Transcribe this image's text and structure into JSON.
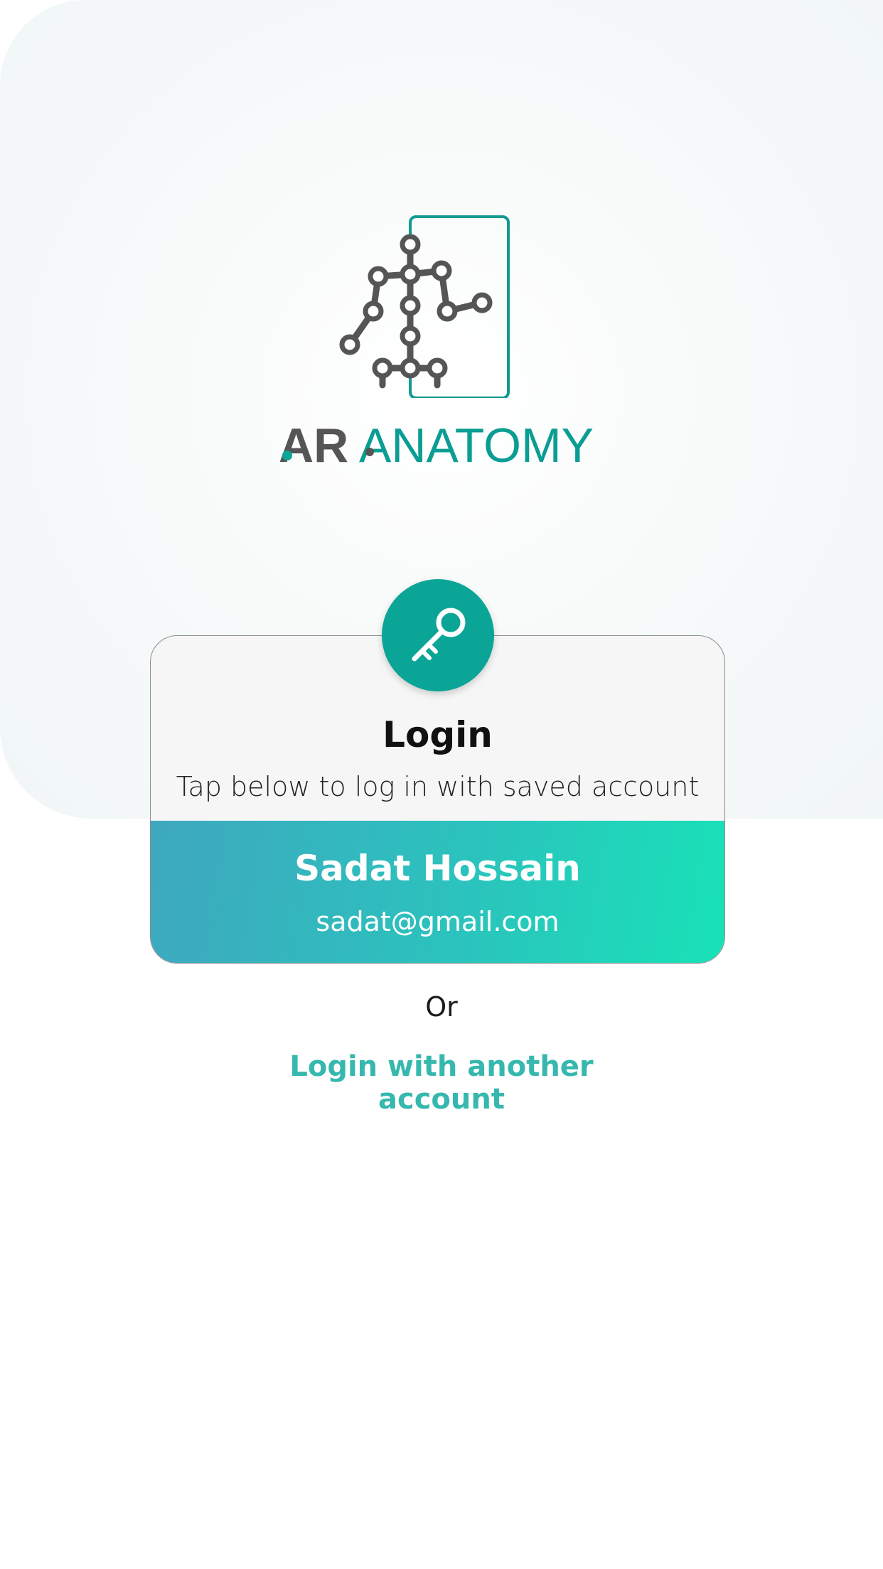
{
  "app": {
    "brand_part1": "AR",
    "brand_part2": "ANATOMY",
    "logo_icon": "skeleton-figure-icon"
  },
  "login_card": {
    "badge_icon": "key-icon",
    "title": "Login",
    "subtitle": "Tap below to log in with saved account",
    "saved_account": {
      "name": "Sadat Hossain",
      "email": "sadat@gmail.com"
    }
  },
  "separator_text": "Or",
  "alt_login_label": "Login with another account",
  "colors": {
    "accent_teal": "#0aa596",
    "logo_gray": "#555555",
    "link_teal": "#36b8ae",
    "gradient_start": "#3ea8bf",
    "gradient_end": "#18e2b7"
  }
}
